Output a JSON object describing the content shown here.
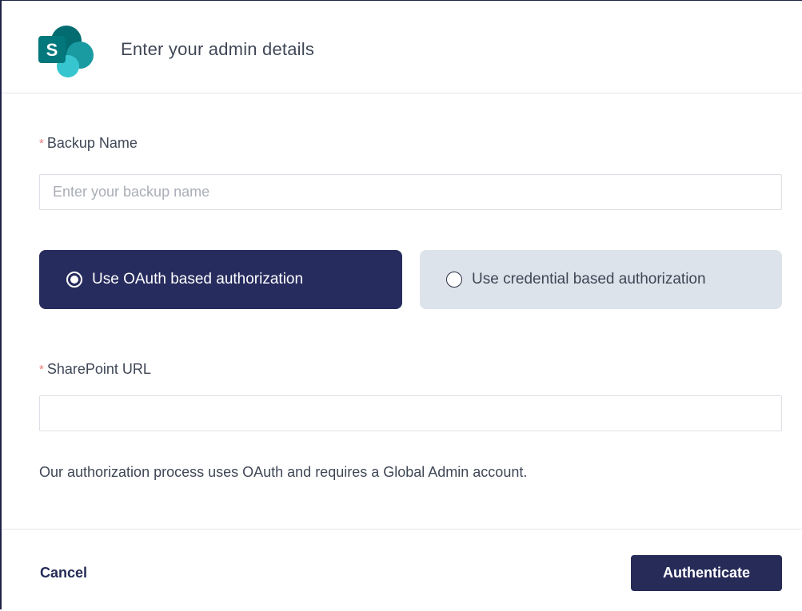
{
  "header": {
    "title": "Enter your admin details",
    "logo_icon": "sharepoint-logo-icon",
    "logo_letter": "S"
  },
  "form": {
    "backup_name": {
      "required_mark": "*",
      "label": "Backup Name",
      "placeholder": "Enter your backup name",
      "value": ""
    },
    "auth_options": [
      {
        "label": "Use OAuth based authorization",
        "selected": true
      },
      {
        "label": "Use credential based authorization",
        "selected": false
      }
    ],
    "sharepoint_url": {
      "required_mark": "*",
      "label": "SharePoint URL",
      "placeholder": "",
      "value": ""
    },
    "helper_text": "Our authorization process uses OAuth and requires a Global Admin account."
  },
  "footer": {
    "cancel_label": "Cancel",
    "submit_label": "Authenticate"
  },
  "colors": {
    "primary": "#262b57",
    "selected_option": "#272c5e",
    "unselected_option": "#dde3ea",
    "required": "#f07c7c"
  }
}
